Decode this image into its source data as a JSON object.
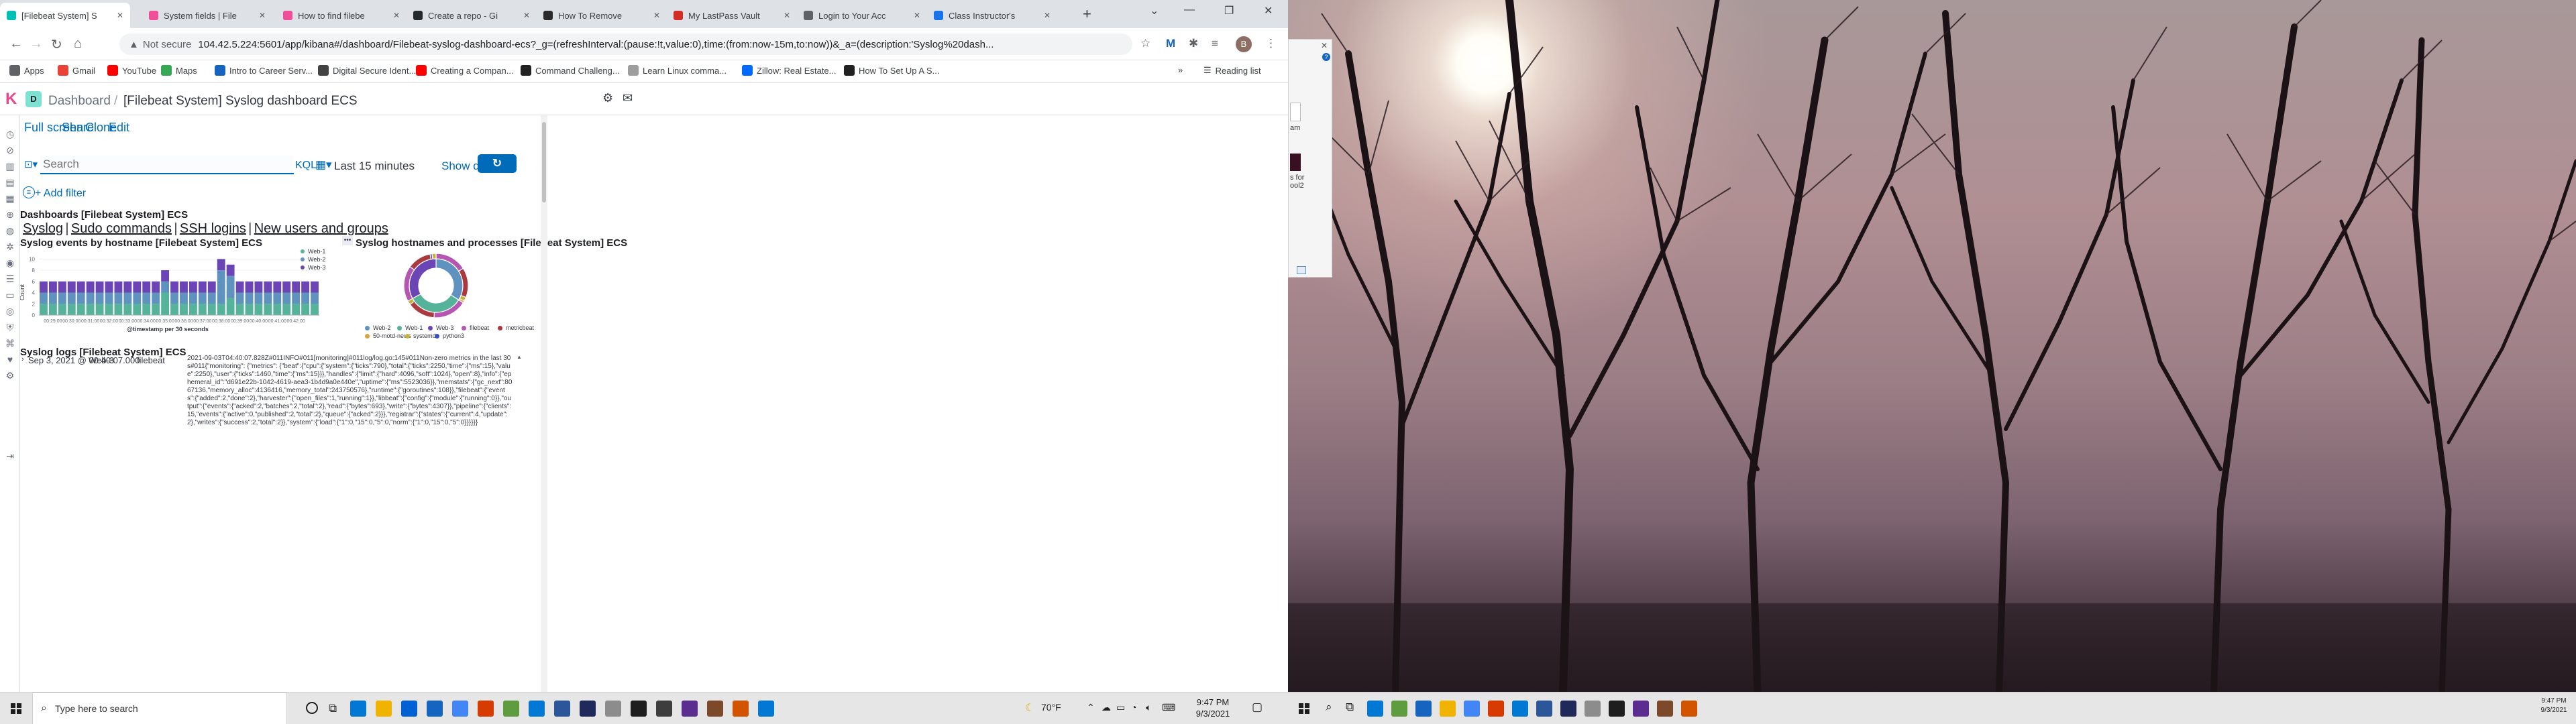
{
  "browser": {
    "tabs": [
      {
        "label": "[Filebeat System] S",
        "color": "#00bfb3",
        "active": true
      },
      {
        "label": "System fields | File",
        "color": "#f04e98"
      },
      {
        "label": "How to find filebe",
        "color": "#f04e98"
      },
      {
        "label": "Create a repo - Gi",
        "color": "#24292e"
      },
      {
        "label": "How To Remove ",
        "color": "#2b2b2b"
      },
      {
        "label": "My LastPass Vault",
        "color": "#d32d27"
      },
      {
        "label": "Login to Your Acc",
        "color": "#5f6368"
      },
      {
        "label": "Class Instructor's",
        "color": "#1a73e8"
      }
    ],
    "new_tab_label": "+",
    "back_icon": "arrow-left-icon",
    "url_security": "Not secure",
    "url": "104.42.5.224:5601/app/kibana#/dashboard/Filebeat-syslog-dashboard-ecs?_g=(refreshInterval:(pause:!t,value:0),time:(from:now-15m,to:now))&_a=(description:'Syslog%20dash...",
    "profile_initial": "B",
    "window_controls": {
      "minimize": "—",
      "restore": "❐",
      "close": "✕"
    },
    "bookmarks": [
      {
        "label": "Apps",
        "color": "#5f6368"
      },
      {
        "label": "Gmail",
        "color": "#ea4335"
      },
      {
        "label": "YouTube",
        "color": "#ff0000"
      },
      {
        "label": "Maps",
        "color": "#34a853"
      },
      {
        "label": "Intro to Career Serv...",
        "color": "#1565c0"
      },
      {
        "label": "Digital Secure Ident...",
        "color": "#424242"
      },
      {
        "label": "Creating a Compan...",
        "color": "#ff0000"
      },
      {
        "label": "Command Challeng...",
        "color": "#212121"
      },
      {
        "label": "Learn Linux comma...",
        "color": "#9e9e9e"
      },
      {
        "label": "Zillow: Real Estate...",
        "color": "#006aff"
      },
      {
        "label": "How To Set Up A S...",
        "color": "#212121"
      }
    ],
    "bookmarks_more": "»",
    "reading_list": "Reading list"
  },
  "kibana": {
    "logo_letter": "K",
    "space_letter": "D",
    "breadcrumbs": [
      "Dashboard",
      "[Filebeat System] Syslog dashboard ECS"
    ],
    "breadcrumb_separator": "/",
    "menu": [
      "Full screen",
      "Share",
      "Clone",
      "Edit"
    ],
    "search_placeholder": "Search",
    "query_language": "KQL",
    "time_range": "Last 15 minutes",
    "show_dates": "Show dates",
    "refresh": "Refresh",
    "add_filter": "+ Add filter",
    "panels": {
      "nav_title": "Dashboards [Filebeat System] ECS",
      "nav_links": [
        "Syslog",
        "Sudo commands",
        "SSH logins",
        "New users and groups"
      ],
      "nav_sep": "|",
      "bar_title": "Syslog events by hostname [Filebeat System] ECS",
      "donut_title": "Syslog hostnames and processes [Filebeat System] ECS",
      "logs_title": "Syslog logs [Filebeat System] ECS",
      "bar_menu": "•••"
    },
    "log_entry": {
      "time": "Sep 3, 2021 @ 00:40:07.000",
      "host": "Web-3",
      "source": "filebeat",
      "message": "2021-09-03T04:40:07.828Z#011INFO#011[monitoring]#011log/log.go:145#011Non-zero metrics in the last 30s#011{\"monitoring\": {\"metrics\": {\"beat\":{\"cpu\":{\"system\":{\"ticks\":790},\"total\":{\"ticks\":2250,\"time\":{\"ms\":15},\"value\":2250},\"user\":{\"ticks\":1460,\"time\":{\"ms\":15}}},\"handles\":{\"limit\":{\"hard\":4096,\"soft\":1024},\"open\":8},\"info\":{\"ephemeral_id\":\"d691e22b-1042-4619-aea3-1b4d9a0e440e\",\"uptime\":{\"ms\":5523036}},\"memstats\":{\"gc_next\":8067136,\"memory_alloc\":4136416,\"memory_total\":243750576},\"runtime\":{\"goroutines\":108}},\"filebeat\":{\"events\":{\"added\":2,\"done\":2},\"harvester\":{\"open_files\":1,\"running\":1}},\"libbeat\":{\"config\":{\"module\":{\"running\":0}},\"output\":{\"events\":{\"acked\":2,\"batches\":2,\"total\":2},\"read\":{\"bytes\":693},\"write\":{\"bytes\":4307}},\"pipeline\":{\"clients\":15,\"events\":{\"active\":0,\"published\":2,\"total\":2},\"queue\":{\"acked\":2}}},\"registrar\":{\"states\":{\"current\":4,\"update\":2},\"writes\":{\"success\":2,\"total\":2}},\"system\":{\"load\":{\"1\":0,\"15\":0,\"5\":0,\"norm\":{\"1\":0,\"15\":0,\"5\":0}}}}}}"
    }
  },
  "chart_data": [
    {
      "type": "bar",
      "stacked": true,
      "title": "Syslog events by hostname [Filebeat System] ECS",
      "xlabel": "@timestamp per 30 seconds",
      "ylabel": "Count",
      "ylim": [
        0,
        11
      ],
      "yticks": [
        0,
        2,
        4,
        6,
        8,
        10
      ],
      "xtick_labels": [
        "00:29:00",
        "00:30:00",
        "00:31:00",
        "00:32:00",
        "00:33:00",
        "00:34:00",
        "00:35:00",
        "00:36:00",
        "00:37:00",
        "00:38:00",
        "00:39:00",
        "00:40:00",
        "00:41:00",
        "00:42:00"
      ],
      "categories": [
        "00:28:30",
        "00:29:00",
        "00:29:30",
        "00:30:00",
        "00:30:30",
        "00:31:00",
        "00:31:30",
        "00:32:00",
        "00:32:30",
        "00:33:00",
        "00:33:30",
        "00:34:00",
        "00:34:30",
        "00:35:00",
        "00:35:30",
        "00:36:00",
        "00:36:30",
        "00:37:00",
        "00:37:30",
        "00:38:00",
        "00:38:30",
        "00:39:00",
        "00:39:30",
        "00:40:00",
        "00:40:30",
        "00:41:00",
        "00:41:30",
        "00:42:00",
        "00:42:30",
        "00:43:00"
      ],
      "series": [
        {
          "name": "Web-1",
          "color": "#54b399",
          "values": [
            2,
            2,
            2,
            2,
            2,
            2,
            2,
            2,
            2,
            2,
            2,
            2,
            2,
            4,
            2,
            2,
            2,
            2,
            2,
            2,
            3,
            2,
            2,
            2,
            2,
            2,
            2,
            2,
            2,
            2
          ]
        },
        {
          "name": "Web-2",
          "color": "#6092c0",
          "values": [
            2,
            2,
            2,
            2,
            2,
            2,
            2,
            2,
            2,
            2,
            2,
            2,
            2,
            2,
            2,
            2,
            2,
            2,
            2,
            6,
            4,
            2,
            2,
            2,
            2,
            2,
            2,
            2,
            2,
            2
          ]
        },
        {
          "name": "Web-3",
          "color": "#6b44b6",
          "values": [
            2,
            2,
            2,
            2,
            2,
            2,
            2,
            2,
            2,
            2,
            2,
            2,
            2,
            2,
            2,
            2,
            2,
            2,
            2,
            2,
            2,
            2,
            2,
            2,
            2,
            2,
            2,
            2,
            2,
            2
          ]
        }
      ]
    },
    {
      "type": "pie",
      "donut": true,
      "title": "Syslog hostnames and processes [Filebeat System] ECS",
      "inner": {
        "labels": [
          "Web-2",
          "Web-1",
          "Web-3"
        ],
        "values": [
          34,
          33,
          33
        ]
      },
      "outer": {
        "labels": [
          "filebeat",
          "metricbeat",
          "systemd",
          "50-motd-news",
          "filebeat",
          "metricbeat",
          "systemd",
          "filebeat",
          "metricbeat",
          "python3",
          "systemd"
        ],
        "parent": [
          "Web-2",
          "Web-2",
          "Web-2",
          "Web-2",
          "Web-1",
          "Web-1",
          "Web-1",
          "Web-3",
          "Web-3",
          "Web-3",
          "Web-3"
        ],
        "values": [
          16,
          15,
          2,
          1,
          17,
          14,
          2,
          18,
          12,
          1,
          2
        ]
      },
      "legend": [
        {
          "label": "Web-2",
          "color": "#6092c0"
        },
        {
          "label": "Web-1",
          "color": "#54b399"
        },
        {
          "label": "Web-3",
          "color": "#6b44b6"
        },
        {
          "label": "filebeat",
          "color": "#b557b2"
        },
        {
          "label": "metricbeat",
          "color": "#aa3a3f"
        },
        {
          "label": "50-motd-news",
          "color": "#d6a43a"
        },
        {
          "label": "systemd",
          "color": "#c6b23a"
        },
        {
          "label": "python3",
          "color": "#3b4ec0"
        }
      ]
    }
  ],
  "taskbar": {
    "search_placeholder": "Type here to search",
    "weather": "70°F",
    "time": "9:47 PM",
    "date": "9/3/2021",
    "second_time": "9:47 PM",
    "second_date": "9/3/2021"
  },
  "partial_window": {
    "lines": [
      "s for",
      "ool2",
      "am"
    ]
  }
}
